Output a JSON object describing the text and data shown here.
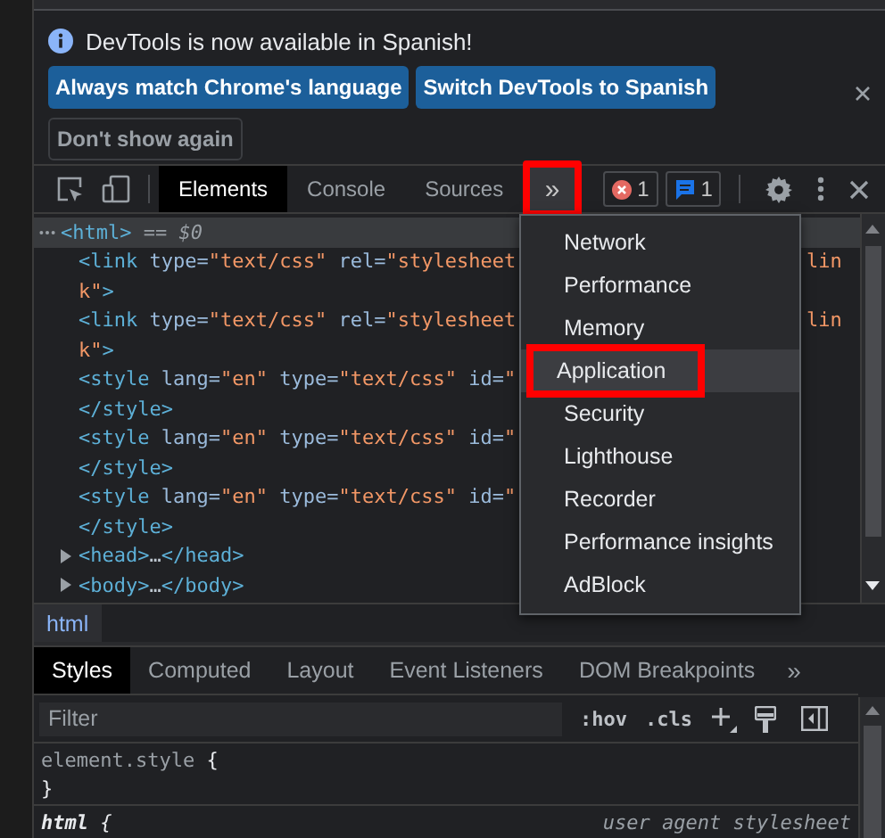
{
  "notice": {
    "message": "DevTools is now available in Spanish!",
    "buttons": [
      {
        "label": "Always match Chrome's language",
        "kind": "primary"
      },
      {
        "label": "Switch DevTools to Spanish",
        "kind": "primary"
      },
      {
        "label": "Don't show again",
        "kind": "secondary"
      }
    ]
  },
  "toolbar": {
    "tabs": [
      {
        "label": "Elements",
        "selected": true
      },
      {
        "label": "Console",
        "selected": false
      },
      {
        "label": "Sources",
        "selected": false
      }
    ],
    "more": {
      "label": "»",
      "expanded": true,
      "highlighted": true
    },
    "badges": [
      {
        "kind": "error",
        "count": "1"
      },
      {
        "kind": "message",
        "count": "1"
      }
    ]
  },
  "elements": {
    "root": {
      "selected": true,
      "segments": [
        {
          "kind": "tag",
          "text": "<html>"
        },
        {
          "kind": "dim",
          "text": " == $0"
        }
      ],
      "children": [
        {
          "lines": [
            [
              {
                "kind": "tag",
                "text": "<link"
              },
              {
                "kind": "attr",
                "text": " type="
              },
              {
                "kind": "value",
                "text": "\"text/css\""
              },
              {
                "kind": "attr",
                "text": " rel="
              },
              {
                "kind": "value",
                "text": "\"stylesheet"
              }
            ],
            [
              {
                "kind": "value",
                "text": "k\""
              },
              {
                "kind": "tag",
                "text": ">"
              }
            ]
          ],
          "tail": "lin"
        },
        {
          "lines": [
            [
              {
                "kind": "tag",
                "text": "<link"
              },
              {
                "kind": "attr",
                "text": " type="
              },
              {
                "kind": "value",
                "text": "\"text/css\""
              },
              {
                "kind": "attr",
                "text": " rel="
              },
              {
                "kind": "value",
                "text": "\"stylesheet"
              }
            ],
            [
              {
                "kind": "value",
                "text": "k\""
              },
              {
                "kind": "tag",
                "text": ">"
              }
            ]
          ],
          "tail": "lin"
        },
        {
          "lines": [
            [
              {
                "kind": "tag",
                "text": "<style"
              },
              {
                "kind": "attr",
                "text": " lang="
              },
              {
                "kind": "value",
                "text": "\"en\""
              },
              {
                "kind": "attr",
                "text": " type="
              },
              {
                "kind": "value",
                "text": "\"text/css\""
              },
              {
                "kind": "attr",
                "text": " id="
              },
              {
                "kind": "value",
                "text": "\""
              }
            ],
            [
              {
                "kind": "tag",
                "text": "</style>"
              }
            ]
          ]
        },
        {
          "lines": [
            [
              {
                "kind": "tag",
                "text": "<style"
              },
              {
                "kind": "attr",
                "text": " lang="
              },
              {
                "kind": "value",
                "text": "\"en\""
              },
              {
                "kind": "attr",
                "text": " type="
              },
              {
                "kind": "value",
                "text": "\"text/css\""
              },
              {
                "kind": "attr",
                "text": " id="
              },
              {
                "kind": "value",
                "text": "\""
              }
            ],
            [
              {
                "kind": "tag",
                "text": "</style>"
              }
            ]
          ]
        },
        {
          "lines": [
            [
              {
                "kind": "tag",
                "text": "<style"
              },
              {
                "kind": "attr",
                "text": " lang="
              },
              {
                "kind": "value",
                "text": "\"en\""
              },
              {
                "kind": "attr",
                "text": " type="
              },
              {
                "kind": "value",
                "text": "\"text/css\""
              },
              {
                "kind": "attr",
                "text": " id="
              },
              {
                "kind": "value",
                "text": "\""
              }
            ],
            [
              {
                "kind": "tag",
                "text": "</style>"
              }
            ]
          ]
        },
        {
          "expanded": false,
          "lines": [
            [
              {
                "kind": "tag",
                "text": "<head>"
              },
              {
                "kind": "plain",
                "text": "…"
              },
              {
                "kind": "tag",
                "text": "</head>"
              }
            ]
          ]
        },
        {
          "expanded": false,
          "lines": [
            [
              {
                "kind": "tag",
                "text": "<body>"
              },
              {
                "kind": "plain",
                "text": "…"
              },
              {
                "kind": "tag",
                "text": "</body>"
              }
            ]
          ]
        }
      ]
    }
  },
  "menu": {
    "items": [
      {
        "label": "Network",
        "selected": false,
        "highlighted": false
      },
      {
        "label": "Performance",
        "selected": false,
        "highlighted": false
      },
      {
        "label": "Memory",
        "selected": false,
        "highlighted": false
      },
      {
        "label": "Application",
        "selected": true,
        "highlighted": true
      },
      {
        "label": "Security",
        "selected": false,
        "highlighted": false
      },
      {
        "label": "Lighthouse",
        "selected": false,
        "highlighted": false
      },
      {
        "label": "Recorder",
        "selected": false,
        "highlighted": false
      },
      {
        "label": "Performance insights",
        "selected": false,
        "highlighted": false
      },
      {
        "label": "AdBlock",
        "selected": false,
        "highlighted": false
      }
    ]
  },
  "breadcrumbs": [
    {
      "label": "html",
      "selected": true
    }
  ],
  "sidebar": {
    "tabs": [
      {
        "label": "Styles",
        "selected": true
      },
      {
        "label": "Computed",
        "selected": false
      },
      {
        "label": "Layout",
        "selected": false
      },
      {
        "label": "Event Listeners",
        "selected": false
      },
      {
        "label": "DOM Breakpoints",
        "selected": false
      }
    ],
    "more": "»",
    "filter": {
      "placeholder": "Filter"
    },
    "toggles": [
      ":hov",
      ".cls"
    ],
    "rules": [
      {
        "kind": "inline",
        "selector": "element.style",
        "open": "{",
        "close": "}"
      },
      {
        "kind": "user-agent",
        "selector": "html",
        "open": "{",
        "source": "user agent stylesheet"
      }
    ]
  }
}
